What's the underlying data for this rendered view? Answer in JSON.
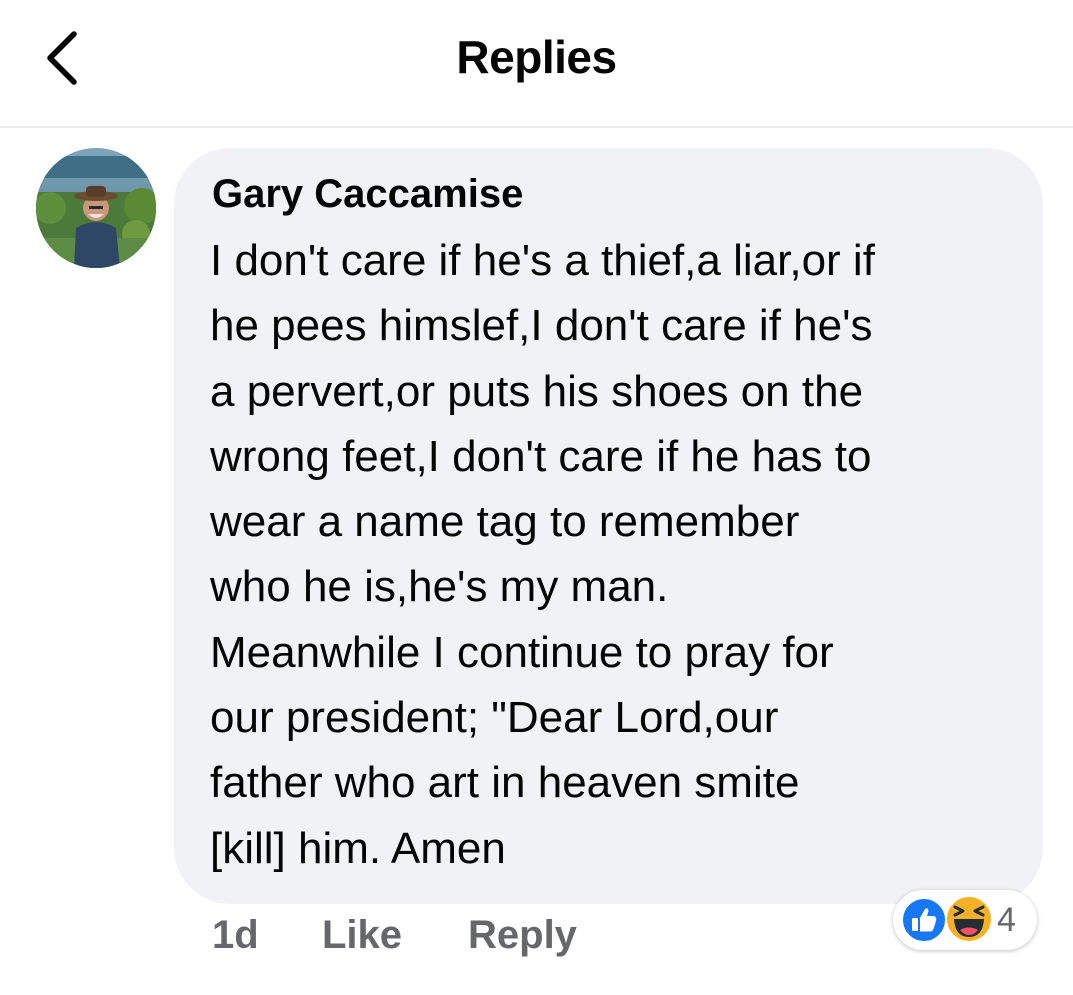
{
  "header": {
    "title": "Replies",
    "back_icon": "chevron-left-icon"
  },
  "comment": {
    "author": "Gary Caccamise",
    "text_lines": [
      "I don't care if he's a thief,a liar,or if",
      "he pees himslef,I don't care if he's",
      "a pervert,or puts his shoes on the",
      "wrong feet,I don't care if he has to",
      "wear a name tag to remember",
      "who he is,he's my man.",
      "Meanwhile I continue to pray for",
      "our president; \"Dear Lord,our",
      "father who art in heaven smite",
      "[kill] him. Amen"
    ],
    "time": "1d",
    "like_label": "Like",
    "reply_label": "Reply",
    "reactions": {
      "icons": [
        "like-reaction-icon",
        "haha-reaction-icon"
      ],
      "count": "4"
    }
  },
  "colors": {
    "bubble": "#f0f2f5",
    "secondary_text": "#65676b",
    "like_blue": "#1877f2",
    "haha_yellow": "#f7b125"
  }
}
